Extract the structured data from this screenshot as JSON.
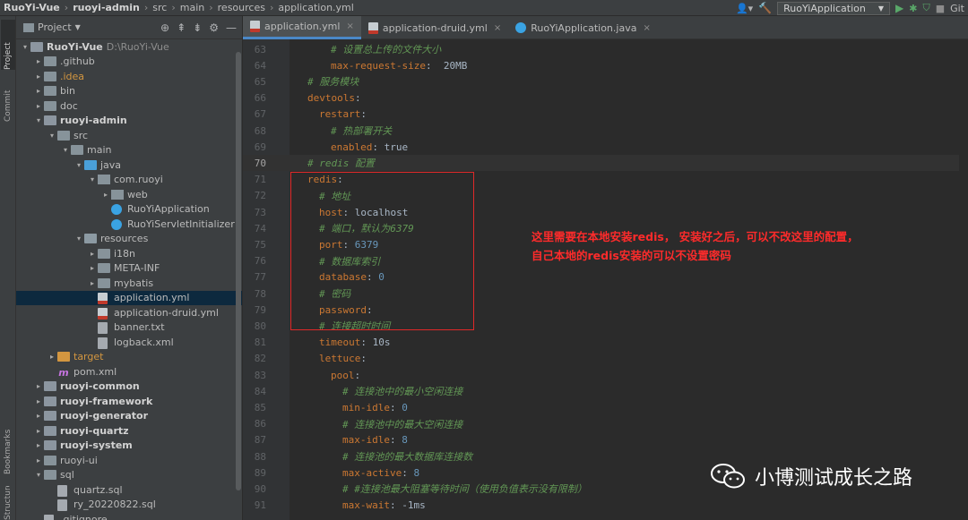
{
  "breadcrumb": [
    "RuoYi-Vue",
    "ruoyi-admin",
    "src",
    "main",
    "resources",
    "application.yml"
  ],
  "run_config": "RuoYiApplication",
  "git_label": "Git",
  "side_tabs": {
    "project": "Project",
    "commit": "Commit",
    "bookmarks": "Bookmarks",
    "structure": "Structure"
  },
  "project_panel": {
    "title": "Project",
    "tree": [
      {
        "indent": 0,
        "arrow": "▾",
        "icon": "mod",
        "label": "RuoYi-Vue",
        "bold": true,
        "extra": "D:\\RuoYi-Vue"
      },
      {
        "indent": 1,
        "arrow": "▸",
        "icon": "fold",
        "label": ".github"
      },
      {
        "indent": 1,
        "arrow": "▸",
        "icon": "fold",
        "label": ".idea",
        "orange": true
      },
      {
        "indent": 1,
        "arrow": "▸",
        "icon": "fold",
        "label": "bin"
      },
      {
        "indent": 1,
        "arrow": "▸",
        "icon": "fold",
        "label": "doc"
      },
      {
        "indent": 1,
        "arrow": "▾",
        "icon": "mod",
        "label": "ruoyi-admin",
        "bold": true
      },
      {
        "indent": 2,
        "arrow": "▾",
        "icon": "fold",
        "label": "src"
      },
      {
        "indent": 3,
        "arrow": "▾",
        "icon": "fold",
        "label": "main"
      },
      {
        "indent": 4,
        "arrow": "▾",
        "icon": "blue",
        "label": "java"
      },
      {
        "indent": 5,
        "arrow": "▾",
        "icon": "pkg",
        "label": "com.ruoyi"
      },
      {
        "indent": 6,
        "arrow": "▸",
        "icon": "pkg",
        "label": "web"
      },
      {
        "indent": 6,
        "arrow": "",
        "icon": "class",
        "label": "RuoYiApplication"
      },
      {
        "indent": 6,
        "arrow": "",
        "icon": "class",
        "label": "RuoYiServletInitializer"
      },
      {
        "indent": 4,
        "arrow": "▾",
        "icon": "res",
        "label": "resources"
      },
      {
        "indent": 5,
        "arrow": "▸",
        "icon": "fold",
        "label": "i18n"
      },
      {
        "indent": 5,
        "arrow": "▸",
        "icon": "fold",
        "label": "META-INF"
      },
      {
        "indent": 5,
        "arrow": "▸",
        "icon": "fold",
        "label": "mybatis"
      },
      {
        "indent": 5,
        "arrow": "",
        "icon": "yml",
        "label": "application.yml",
        "selected": true
      },
      {
        "indent": 5,
        "arrow": "",
        "icon": "yml",
        "label": "application-druid.yml"
      },
      {
        "indent": 5,
        "arrow": "",
        "icon": "file",
        "label": "banner.txt"
      },
      {
        "indent": 5,
        "arrow": "",
        "icon": "file",
        "label": "logback.xml"
      },
      {
        "indent": 2,
        "arrow": "▸",
        "icon": "orange",
        "label": "target",
        "orange": true
      },
      {
        "indent": 2,
        "arrow": "",
        "icon": "maven",
        "label": "pom.xml"
      },
      {
        "indent": 1,
        "arrow": "▸",
        "icon": "mod",
        "label": "ruoyi-common",
        "bold": true
      },
      {
        "indent": 1,
        "arrow": "▸",
        "icon": "mod",
        "label": "ruoyi-framework",
        "bold": true
      },
      {
        "indent": 1,
        "arrow": "▸",
        "icon": "mod",
        "label": "ruoyi-generator",
        "bold": true
      },
      {
        "indent": 1,
        "arrow": "▸",
        "icon": "mod",
        "label": "ruoyi-quartz",
        "bold": true
      },
      {
        "indent": 1,
        "arrow": "▸",
        "icon": "mod",
        "label": "ruoyi-system",
        "bold": true
      },
      {
        "indent": 1,
        "arrow": "▸",
        "icon": "fold",
        "label": "ruoyi-ui"
      },
      {
        "indent": 1,
        "arrow": "▾",
        "icon": "fold",
        "label": "sql"
      },
      {
        "indent": 2,
        "arrow": "",
        "icon": "file",
        "label": "quartz.sql"
      },
      {
        "indent": 2,
        "arrow": "",
        "icon": "file",
        "label": "ry_20220822.sql"
      },
      {
        "indent": 1,
        "arrow": "",
        "icon": "file",
        "label": ".gitignore"
      }
    ]
  },
  "tabs": [
    {
      "label": "application.yml",
      "active": true
    },
    {
      "label": "application-druid.yml",
      "active": false
    },
    {
      "label": "RuoYiApplication.java",
      "active": false
    }
  ],
  "code_lines": [
    {
      "n": "63",
      "ind": 2,
      "parts": [
        [
          "c",
          "# 设置总上传的文件大小"
        ]
      ]
    },
    {
      "n": "64",
      "ind": 2,
      "parts": [
        [
          "k",
          "max-request-size"
        ],
        [
          "v",
          ":  20MB"
        ]
      ]
    },
    {
      "n": "65",
      "ind": 0,
      "parts": [
        [
          "c",
          "# 服务模块"
        ]
      ]
    },
    {
      "n": "66",
      "ind": 0,
      "parts": [
        [
          "k",
          "devtools"
        ],
        [
          "v",
          ":"
        ]
      ]
    },
    {
      "n": "67",
      "ind": 1,
      "parts": [
        [
          "k",
          "restart"
        ],
        [
          "v",
          ":"
        ]
      ]
    },
    {
      "n": "68",
      "ind": 2,
      "parts": [
        [
          "c",
          "# 热部署开关"
        ]
      ]
    },
    {
      "n": "69",
      "ind": 2,
      "parts": [
        [
          "k",
          "enabled"
        ],
        [
          "v",
          ": true"
        ]
      ]
    },
    {
      "n": "70",
      "ind": 0,
      "parts": [
        [
          "c",
          "# redis 配置"
        ]
      ],
      "current": true
    },
    {
      "n": "71",
      "ind": 0,
      "parts": [
        [
          "k",
          "redis"
        ],
        [
          "v",
          ":"
        ]
      ]
    },
    {
      "n": "72",
      "ind": 1,
      "parts": [
        [
          "c",
          "# 地址"
        ]
      ]
    },
    {
      "n": "73",
      "ind": 1,
      "parts": [
        [
          "k",
          "host"
        ],
        [
          "v",
          ": localhost"
        ]
      ]
    },
    {
      "n": "74",
      "ind": 1,
      "parts": [
        [
          "c",
          "# 端口，默认为6379"
        ]
      ]
    },
    {
      "n": "75",
      "ind": 1,
      "parts": [
        [
          "k",
          "port"
        ],
        [
          "v",
          ": "
        ],
        [
          "n",
          "6379"
        ]
      ]
    },
    {
      "n": "76",
      "ind": 1,
      "parts": [
        [
          "c",
          "# 数据库索引"
        ]
      ]
    },
    {
      "n": "77",
      "ind": 1,
      "parts": [
        [
          "k",
          "database"
        ],
        [
          "v",
          ": "
        ],
        [
          "n",
          "0"
        ]
      ]
    },
    {
      "n": "78",
      "ind": 1,
      "parts": [
        [
          "c",
          "# 密码"
        ]
      ]
    },
    {
      "n": "79",
      "ind": 1,
      "parts": [
        [
          "k",
          "password"
        ],
        [
          "v",
          ":"
        ]
      ]
    },
    {
      "n": "80",
      "ind": 1,
      "parts": [
        [
          "c",
          "# 连接超时时间"
        ]
      ]
    },
    {
      "n": "81",
      "ind": 1,
      "parts": [
        [
          "k",
          "timeout"
        ],
        [
          "v",
          ": 10s"
        ]
      ]
    },
    {
      "n": "82",
      "ind": 1,
      "parts": [
        [
          "k",
          "lettuce"
        ],
        [
          "v",
          ":"
        ]
      ]
    },
    {
      "n": "83",
      "ind": 2,
      "parts": [
        [
          "k",
          "pool"
        ],
        [
          "v",
          ":"
        ]
      ]
    },
    {
      "n": "84",
      "ind": 3,
      "parts": [
        [
          "c",
          "# 连接池中的最小空闲连接"
        ]
      ]
    },
    {
      "n": "85",
      "ind": 3,
      "parts": [
        [
          "k",
          "min-idle"
        ],
        [
          "v",
          ": "
        ],
        [
          "n",
          "0"
        ]
      ]
    },
    {
      "n": "86",
      "ind": 3,
      "parts": [
        [
          "c",
          "# 连接池中的最大空闲连接"
        ]
      ]
    },
    {
      "n": "87",
      "ind": 3,
      "parts": [
        [
          "k",
          "max-idle"
        ],
        [
          "v",
          ": "
        ],
        [
          "n",
          "8"
        ]
      ]
    },
    {
      "n": "88",
      "ind": 3,
      "parts": [
        [
          "c",
          "# 连接池的最大数据库连接数"
        ]
      ]
    },
    {
      "n": "89",
      "ind": 3,
      "parts": [
        [
          "k",
          "max-active"
        ],
        [
          "v",
          ": "
        ],
        [
          "n",
          "8"
        ]
      ]
    },
    {
      "n": "90",
      "ind": 3,
      "parts": [
        [
          "c",
          "# #连接池最大阻塞等待时间（使用负值表示没有限制）"
        ]
      ]
    },
    {
      "n": "91",
      "ind": 3,
      "parts": [
        [
          "k",
          "max-wait"
        ],
        [
          "v",
          ": -1ms"
        ]
      ]
    }
  ],
  "annotation": {
    "line1": "这里需要在本地安装redis， 安装好之后，可以不改这里的配置，",
    "line2": "自己本地的redis安装的可以不设置密码"
  },
  "watermark": "小博测试成长之路",
  "colors": {
    "accent": "#4a88c7",
    "annotation": "#ff2b2b",
    "keyword": "#cc7832",
    "comment": "#629755"
  }
}
